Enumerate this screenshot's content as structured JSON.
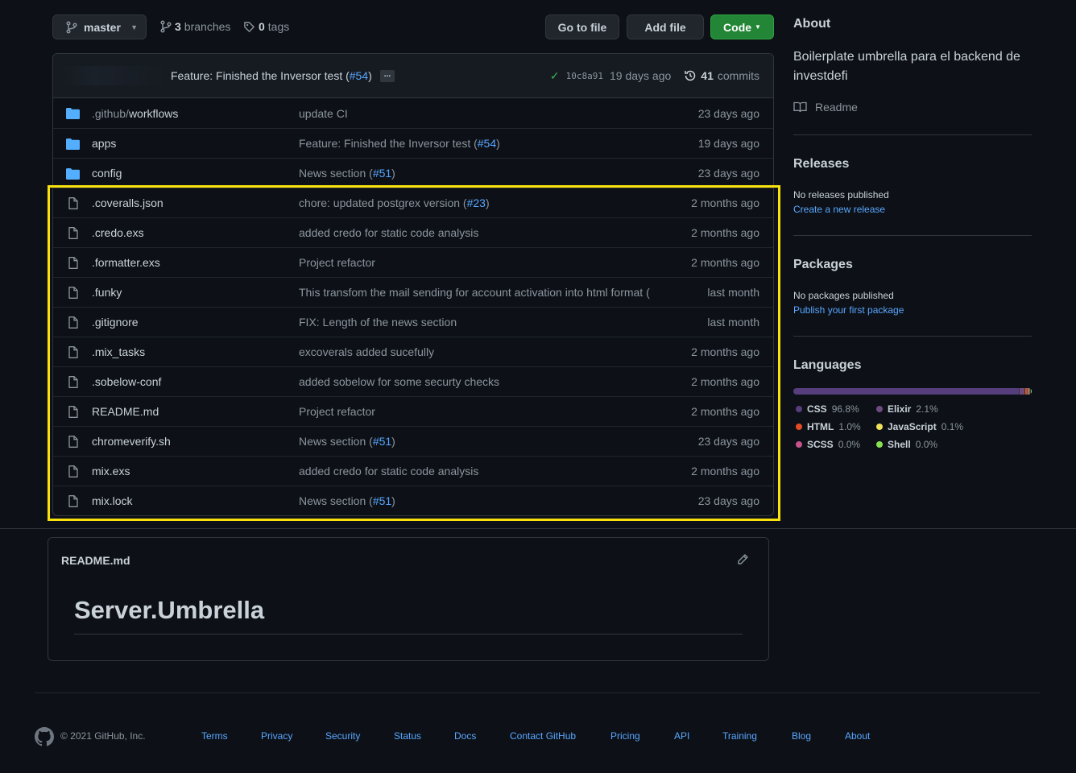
{
  "toolbar": {
    "branch": "master",
    "branches_count": "3",
    "branches_label": "branches",
    "tags_count": "0",
    "tags_label": "tags",
    "go_to_file": "Go to file",
    "add_file": "Add file",
    "code": "Code"
  },
  "latest_commit": {
    "message": "Feature: Finished the Inversor test (",
    "pr": "#54",
    "message_end": ")",
    "more": "...",
    "sha": "10c8a91",
    "age": "19 days ago",
    "commits_count": "41",
    "commits_label": "commits"
  },
  "files": [
    {
      "type": "dir",
      "name_prefix": ".github/",
      "name": "workflows",
      "message": "update CI",
      "pr": "",
      "message_end": "",
      "age": "23 days ago"
    },
    {
      "type": "dir",
      "name_prefix": "",
      "name": "apps",
      "message": "Feature: Finished the Inversor test (",
      "pr": "#54",
      "message_end": ")",
      "age": "19 days ago"
    },
    {
      "type": "dir",
      "name_prefix": "",
      "name": "config",
      "message": "News section (",
      "pr": "#51",
      "message_end": ")",
      "age": "23 days ago"
    },
    {
      "type": "file",
      "name_prefix": "",
      "name": ".coveralls.json",
      "message": "chore: updated postgrex version (",
      "pr": "#23",
      "message_end": ")",
      "age": "2 months ago"
    },
    {
      "type": "file",
      "name_prefix": "",
      "name": ".credo.exs",
      "message": "added credo for static code analysis",
      "pr": "",
      "message_end": "",
      "age": "2 months ago"
    },
    {
      "type": "file",
      "name_prefix": "",
      "name": ".formatter.exs",
      "message": "Project refactor",
      "pr": "",
      "message_end": "",
      "age": "2 months ago"
    },
    {
      "type": "file",
      "name_prefix": "",
      "name": ".funky",
      "message": "This transfom the mail sending for account activation into html format (",
      "pr": "",
      "message_end": "",
      "age": "last month"
    },
    {
      "type": "file",
      "name_prefix": "",
      "name": ".gitignore",
      "message": "FIX: Length of the news section",
      "pr": "",
      "message_end": "",
      "age": "last month"
    },
    {
      "type": "file",
      "name_prefix": "",
      "name": ".mix_tasks",
      "message": "excoverals added sucefully",
      "pr": "",
      "message_end": "",
      "age": "2 months ago"
    },
    {
      "type": "file",
      "name_prefix": "",
      "name": ".sobelow-conf",
      "message": "added sobelow for some securty checks",
      "pr": "",
      "message_end": "",
      "age": "2 months ago"
    },
    {
      "type": "file",
      "name_prefix": "",
      "name": "README.md",
      "message": "Project refactor",
      "pr": "",
      "message_end": "",
      "age": "2 months ago"
    },
    {
      "type": "file",
      "name_prefix": "",
      "name": "chromeverify.sh",
      "message": "News section (",
      "pr": "#51",
      "message_end": ")",
      "age": "23 days ago"
    },
    {
      "type": "file",
      "name_prefix": "",
      "name": "mix.exs",
      "message": "added credo for static code analysis",
      "pr": "",
      "message_end": "",
      "age": "2 months ago"
    },
    {
      "type": "file",
      "name_prefix": "",
      "name": "mix.lock",
      "message": "News section (",
      "pr": "#51",
      "message_end": ")",
      "age": "23 days ago"
    }
  ],
  "readme": {
    "title": "README.md",
    "heading": "Server.Umbrella"
  },
  "sidebar": {
    "about_title": "About",
    "about_text": "Boilerplate umbrella para el backend de investdefi",
    "readme_link": "Readme",
    "releases_title": "Releases",
    "releases_text": "No releases published",
    "releases_link": "Create a new release",
    "packages_title": "Packages",
    "packages_text": "No packages published",
    "packages_link": "Publish your first package",
    "languages_title": "Languages",
    "languages": [
      {
        "name": "CSS",
        "percent": "96.8%",
        "value": 96.8,
        "color": "#563d7c"
      },
      {
        "name": "Elixir",
        "percent": "2.1%",
        "value": 2.1,
        "color": "#6e4a7e"
      },
      {
        "name": "HTML",
        "percent": "1.0%",
        "value": 1.0,
        "color": "#e34c26"
      },
      {
        "name": "JavaScript",
        "percent": "0.1%",
        "value": 0.1,
        "color": "#f1e05a"
      },
      {
        "name": "SCSS",
        "percent": "0.0%",
        "value": 0.0,
        "color": "#c6538c"
      },
      {
        "name": "Shell",
        "percent": "0.0%",
        "value": 0.0,
        "color": "#89e051"
      }
    ]
  },
  "footer": {
    "copyright": "© 2021 GitHub, Inc.",
    "links": [
      "Terms",
      "Privacy",
      "Security",
      "Status",
      "Docs",
      "Contact GitHub",
      "Pricing",
      "API",
      "Training",
      "Blog",
      "About"
    ]
  }
}
